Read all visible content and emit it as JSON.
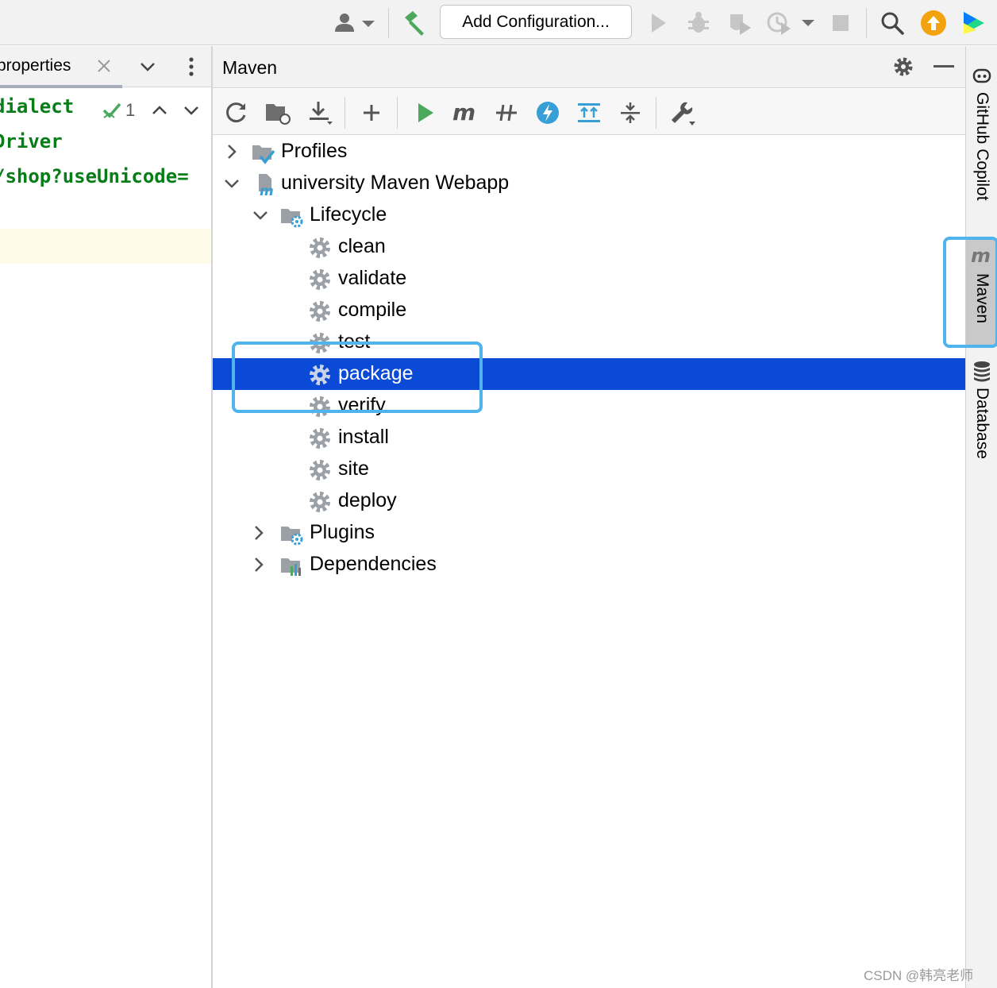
{
  "toolbar": {
    "add_configuration": "Add Configuration..."
  },
  "editor": {
    "tab_label": "properties",
    "inspection_count": "1",
    "code_lines": [
      "dialect",
      "Driver",
      "/shop?useUnicode="
    ]
  },
  "maven": {
    "title": "Maven",
    "tree": {
      "profiles": "Profiles",
      "project": "university Maven Webapp",
      "lifecycle": "Lifecycle",
      "phases": [
        "clean",
        "validate",
        "compile",
        "test",
        "package",
        "verify",
        "install",
        "site",
        "deploy"
      ],
      "selected_phase": "package",
      "plugins": "Plugins",
      "dependencies": "Dependencies"
    }
  },
  "right_strip": {
    "copilot": "GitHub Copilot",
    "maven": "Maven",
    "database": "Database"
  },
  "watermark": "CSDN @韩亮老师",
  "colors": {
    "selection": "#0b4ad6",
    "annotation": "#4fb3ee",
    "run_green": "#4ba85c",
    "update_orange": "#f2a30f",
    "code_green": "#067d17"
  },
  "icons": {
    "user": "user-icon",
    "build": "hammer-icon",
    "run": "run-icon",
    "debug": "debug-icon",
    "coverage": "coverage-icon",
    "profiler": "profiler-icon",
    "stop": "stop-icon",
    "search": "search-icon",
    "update": "update-icon",
    "lifecycle_phase": "gear-icon"
  }
}
